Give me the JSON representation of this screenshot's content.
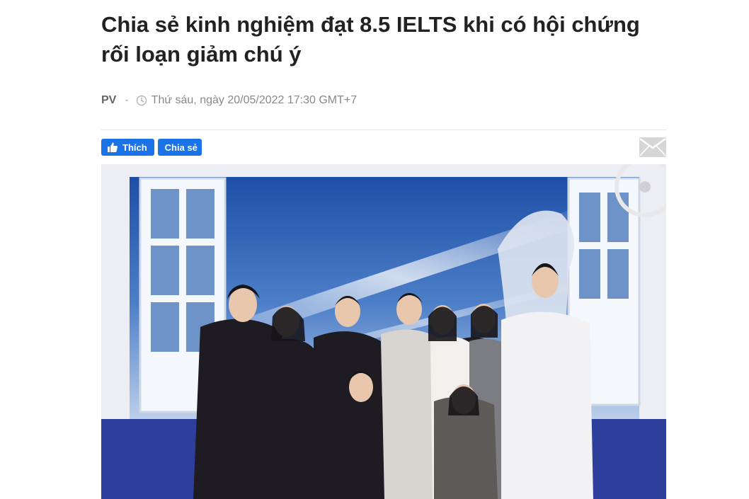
{
  "article": {
    "title": "Chia sẻ kinh nghiệm đạt 8.5 IELTS khi có hội chứng rối loạn giảm chú ý",
    "author": "PV",
    "separator": "-",
    "date": "Thứ sáu, ngày 20/05/2022 17:30 GMT+7"
  },
  "social": {
    "like_label": "Thích",
    "share_label": "Chia sẻ",
    "like_icon": "thumbs-up-icon",
    "mail_icon": "mail-icon",
    "accent": "#1a73e8"
  },
  "photo": {
    "subject": "group-photo"
  }
}
